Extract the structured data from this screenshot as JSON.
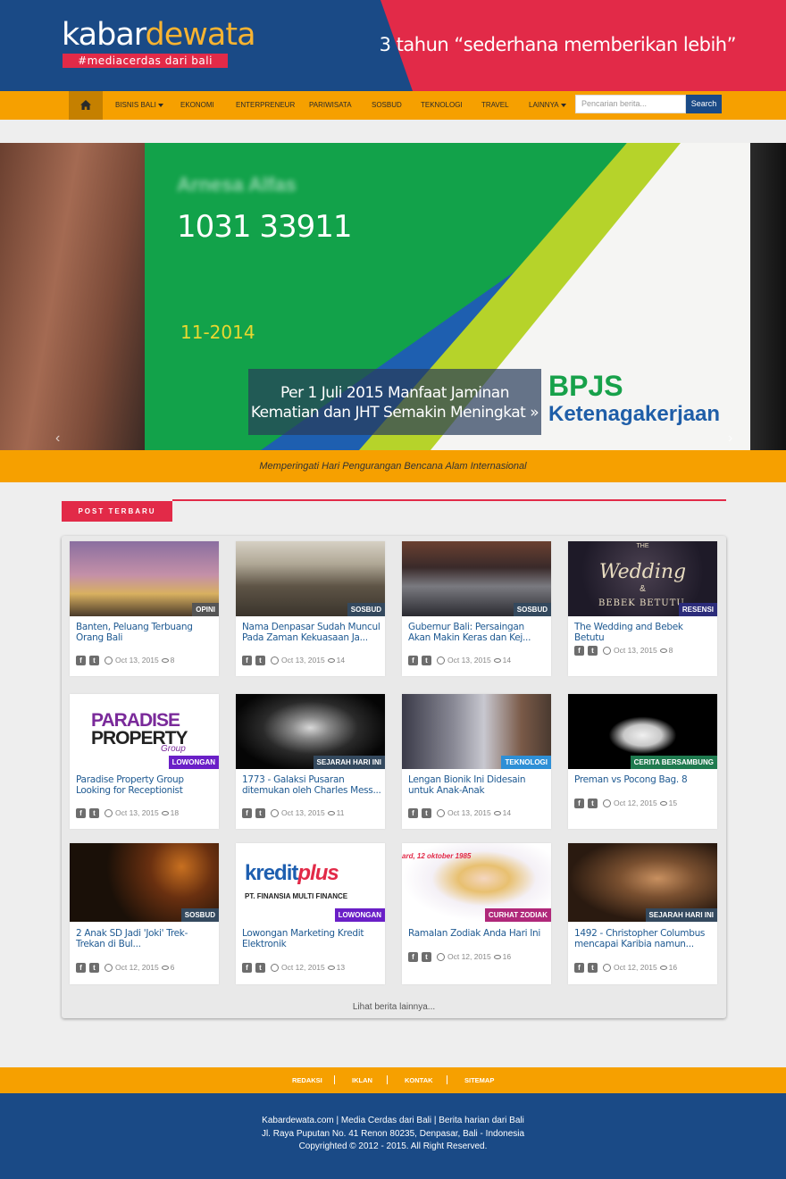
{
  "brand": {
    "word1": "kabar",
    "word2": "dewata",
    "tagline": "#mediacerdas dari bali",
    "slogan": "3 tahun “sederhana memberikan lebih”"
  },
  "colors": {
    "navy": "#1a4a86",
    "red": "#e22a48",
    "orange": "#f6a000"
  },
  "nav": {
    "home_icon": "home-icon",
    "items": [
      "BISNIS BALI",
      "EKONOMI",
      "ENTERPRENEUR",
      "PARIWISATA",
      "SOSBUD",
      "TEKNOLOGI",
      "TRAVEL",
      "LAINNYA"
    ]
  },
  "search": {
    "placeholder": "Pencarian berita...",
    "button": "Search"
  },
  "slider": {
    "card_name": "Arnesa Alfas",
    "card_number": "1031 33911",
    "card_date": "11-2014",
    "logo_line1": "BPJS",
    "logo_line2": "Ketenagakerjaan",
    "caption": "Per 1 Juli 2015 Manfaat Jaminan Kematian dan JHT Semakin Meningkat »",
    "prev": "‹",
    "next": "›"
  },
  "ticker": "Memperingati Hari Pengurangan Bencana Alam Internasional",
  "section": {
    "title": "POST TERBARU"
  },
  "posts": [
    {
      "title": "Banten, Peluang Terbuang Orang Bali",
      "category": "OPINI",
      "date": "Oct 13, 2015",
      "views": "8",
      "cat_color": "#555555"
    },
    {
      "title": "Nama Denpasar Sudah Muncul Pada Zaman Kekuasaan Ja...",
      "category": "SOSBUD",
      "date": "Oct 13, 2015",
      "views": "14",
      "cat_color": "#34495e"
    },
    {
      "title": "Gubernur Bali: Persaingan Akan Makin Keras dan Kej...",
      "category": "SOSBUD",
      "date": "Oct 13, 2015",
      "views": "14",
      "cat_color": "#34495e"
    },
    {
      "title": "The Wedding and Bebek Betutu",
      "category": "RESENSI",
      "date": "Oct 13, 2015",
      "views": "8",
      "cat_color": "#2c2c7a"
    },
    {
      "title": "Paradise Property Group Looking for Receptionist",
      "category": "LOWONGAN",
      "date": "Oct 13, 2015",
      "views": "18",
      "cat_color": "#6a1fc7"
    },
    {
      "title": "1773 - Galaksi Pusaran ditemukan oleh Charles Mess...",
      "category": "SEJARAH HARI INI",
      "date": "Oct 13, 2015",
      "views": "11",
      "cat_color": "#34495e"
    },
    {
      "title": "Lengan Bionik Ini Didesain untuk Anak-Anak",
      "category": "TEKNOLOGI",
      "date": "Oct 13, 2015",
      "views": "14",
      "cat_color": "#2e8fd6"
    },
    {
      "title": "Preman vs Pocong Bag. 8",
      "category": "CERITA BERSAMBUNG",
      "date": "Oct 12, 2015",
      "views": "15",
      "cat_color": "#1f7a4f"
    },
    {
      "title": "2 Anak SD Jadi 'Joki' Trek-Trekan di Bul...",
      "category": "SOSBUD",
      "date": "Oct 12, 2015",
      "views": "6",
      "cat_color": "#34495e"
    },
    {
      "title": "Lowongan Marketing Kredit Elektronik",
      "category": "LOWONGAN",
      "date": "Oct 12, 2015",
      "views": "13",
      "cat_color": "#6a1fc7"
    },
    {
      "title": "Ramalan Zodiak Anda Hari Ini",
      "category": "CURHAT ZODIAK",
      "date": "Oct 12, 2015",
      "views": "16",
      "cat_color": "#b0287a"
    },
    {
      "title": "1492 - Christopher Columbus mencapai Karibia namun...",
      "category": "SEJARAH HARI INI",
      "date": "Oct 12, 2015",
      "views": "16",
      "cat_color": "#34495e"
    }
  ],
  "thumb_text": {
    "wedding_top": "THE",
    "wedding_mid": "Wedding",
    "wedding_amp": "&",
    "wedding_bot": "BEBEK BETUTU",
    "paradise1": "PARADISE",
    "paradise2": "PROPERTY",
    "paradise3": "Group",
    "kredit1": "kredit",
    "kredit2": "plus",
    "kredit3": "PT. FINANSIA MULTI FINANCE",
    "zodiak": "ard, 12 oktober 1985"
  },
  "more_link": "Lihat berita lainnya...",
  "footer_nav": [
    "REDAKSI",
    "IKLAN",
    "KONTAK",
    "SITEMAP"
  ],
  "footer": {
    "line1": "Kabardewata.com | Media Cerdas dari Bali | Berita harian dari Bali",
    "line2": "Jl. Raya Puputan No. 41 Renon 80235, Denpasar, Bali - Indonesia",
    "line3": "Copyrighted © 2012 - 2015. All Right Reserved."
  }
}
